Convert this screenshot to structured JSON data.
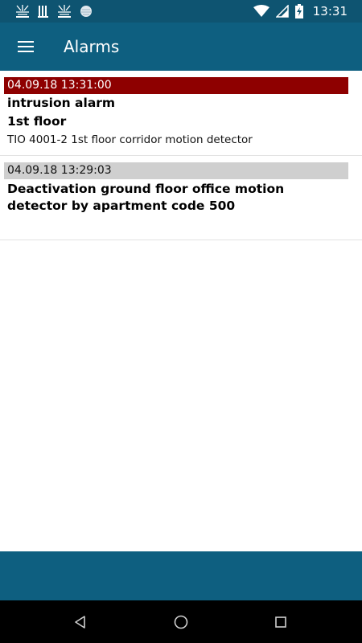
{
  "status_bar": {
    "time": "13:31",
    "notification_icons": [
      "app-notification-icon",
      "signal-notification-icon",
      "app-notification-icon",
      "dot-notification-icon"
    ],
    "right_icons": [
      "wifi-icon",
      "cellular-signal-icon",
      "battery-charging-icon"
    ]
  },
  "app_bar": {
    "title": "Alarms",
    "menu_icon": "hamburger-menu-icon"
  },
  "alarms": [
    {
      "timestamp": "04.09.18 13:31:00",
      "severity_color": "#8e0000",
      "title": "intrusion alarm",
      "location": "1st floor",
      "description": "TIO 4001-2 1st floor corridor motion detector"
    },
    {
      "timestamp": "04.09.18 13:29:03",
      "severity_color": "#cfcfcf",
      "title": "Deactivation ground floor office motion detector by apartment code 500"
    }
  ],
  "nav_bar": {
    "icons": [
      "back-icon",
      "home-icon",
      "recent-apps-icon"
    ]
  },
  "colors": {
    "primary": "#0e5f80",
    "status_bar": "#0e5471",
    "alarm_red": "#8e0000",
    "info_grey": "#cfcfcf"
  }
}
